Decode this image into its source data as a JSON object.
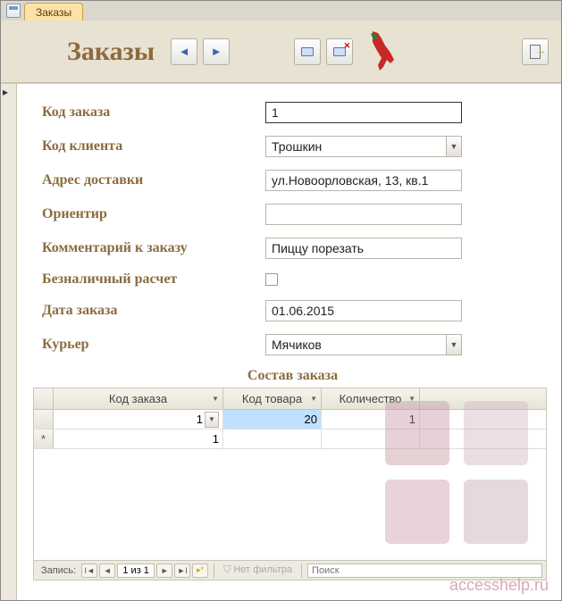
{
  "tab": {
    "label": "Заказы"
  },
  "header": {
    "title": "Заказы"
  },
  "fields": {
    "order_id": {
      "label": "Код заказа",
      "value": "1"
    },
    "client_id": {
      "label": "Код клиента",
      "value": "Трошкин"
    },
    "address": {
      "label": "Адрес доставки",
      "value": "ул.Новоорловская, 13, кв.1"
    },
    "landmark": {
      "label": "Ориентир",
      "value": ""
    },
    "comment": {
      "label": "Комментарий к заказу",
      "value": "Пиццу порезать"
    },
    "cashless": {
      "label": "Безналичный расчет",
      "checked": false
    },
    "order_date": {
      "label": "Дата заказа",
      "value": "01.06.2015"
    },
    "courier": {
      "label": "Курьер",
      "value": "Мячиков"
    }
  },
  "section_title": "Состав заказа",
  "grid": {
    "columns": [
      "Код заказа",
      "Код товара",
      "Количество"
    ],
    "rows": [
      {
        "order_id": "1",
        "product_id": "20",
        "qty": "1"
      }
    ],
    "nav": {
      "label": "Запись:",
      "position": "1 из 1",
      "filter": "Нет фильтра",
      "search": "Поиск"
    }
  },
  "watermark": "accesshelp.ru"
}
